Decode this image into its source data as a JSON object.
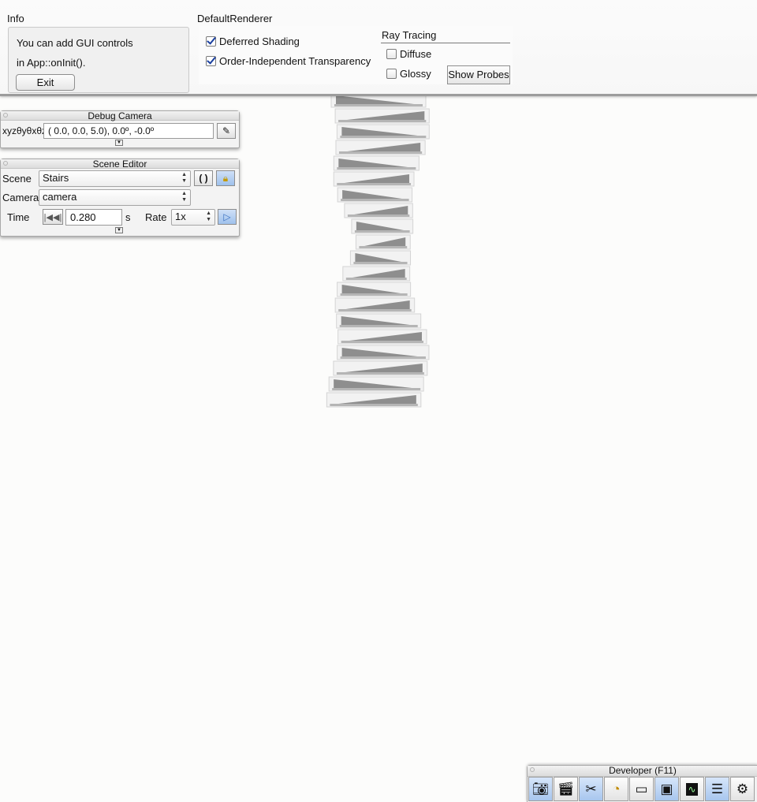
{
  "info": {
    "title": "Info",
    "line1": "You can add GUI controls",
    "line2": "in App::onInit().",
    "exit_label": "Exit"
  },
  "renderer": {
    "title": "DefaultRenderer",
    "deferred_label": "Deferred Shading",
    "oit_label": "Order-Independent Transparency",
    "ray_tracing_title": "Ray Tracing",
    "diffuse_label": "Diffuse",
    "glossy_label": "Glossy",
    "show_probes_label": "Show Probes",
    "deferred_checked": true,
    "oit_checked": true,
    "diffuse_checked": false,
    "glossy_checked": false
  },
  "debug_camera": {
    "title": "Debug Camera",
    "coord_label": "xyzθyθxθz",
    "value": "(  0.0,   0.0,   5.0),   0.0º,  -0.0º"
  },
  "scene_editor": {
    "title": "Scene Editor",
    "scene_label": "Scene",
    "scene_value": "Stairs",
    "camera_label": "Camera",
    "camera_value": "camera",
    "time_label": "Time",
    "time_value": "0.280",
    "time_unit": "s",
    "rate_label": "Rate",
    "rate_value": "1x"
  },
  "developer": {
    "title": "Developer (F11)",
    "tools": [
      {
        "icon": "camera-icon",
        "active": true
      },
      {
        "icon": "clapperboard-icon",
        "active": false
      },
      {
        "icon": "tools-icon",
        "active": true
      },
      {
        "icon": "gauge-icon",
        "active": false
      },
      {
        "icon": "note-icon",
        "active": false
      },
      {
        "icon": "window-layout-icon",
        "active": true
      },
      {
        "icon": "profiler-icon",
        "active": false
      },
      {
        "icon": "log-icon",
        "active": true
      },
      {
        "icon": "gear-icon",
        "active": false
      }
    ]
  },
  "colors": {
    "background": "#fcfcfb",
    "accent_blue": "#a8c6ee",
    "check_mark": "#1a3f9e"
  }
}
